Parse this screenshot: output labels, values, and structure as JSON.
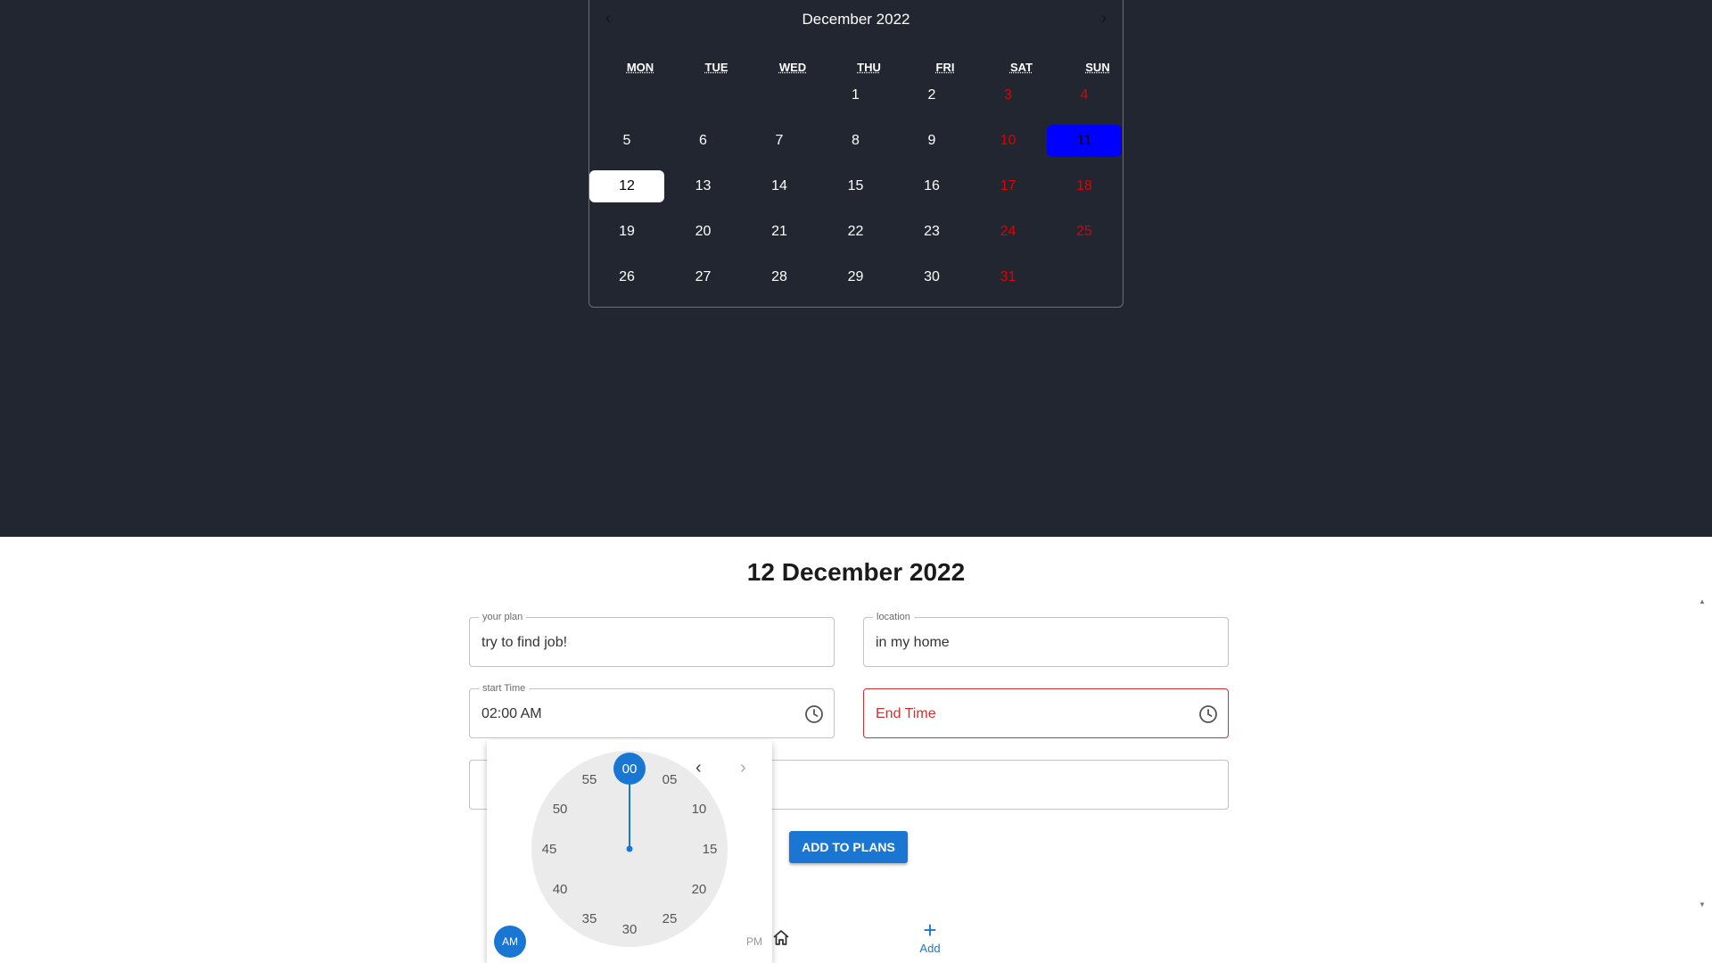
{
  "colors": {
    "accent": "#1976d2",
    "weekend": "#e00000",
    "today_bg": "#0000ff",
    "dark_bg": "#222630",
    "error": "#d32f2f"
  },
  "calendar": {
    "title": "December 2022",
    "prev_label": "‹",
    "next_label": "›",
    "weekdays": [
      "MON",
      "TUE",
      "WED",
      "THU",
      "FRI",
      "SAT",
      "SUN"
    ],
    "weeks": [
      [
        "",
        "",
        "",
        "1",
        "2",
        "3",
        "4"
      ],
      [
        "5",
        "6",
        "7",
        "8",
        "9",
        "10",
        "11"
      ],
      [
        "12",
        "13",
        "14",
        "15",
        "16",
        "17",
        "18"
      ],
      [
        "19",
        "20",
        "21",
        "22",
        "23",
        "24",
        "25"
      ],
      [
        "26",
        "27",
        "28",
        "29",
        "30",
        "31",
        ""
      ]
    ],
    "today": "11",
    "selected": "12"
  },
  "form": {
    "heading": "12 December 2022",
    "plan": {
      "label": "your plan",
      "value": "try to find job!"
    },
    "location": {
      "label": "location",
      "value": "in my home"
    },
    "start_time": {
      "label": "start Time",
      "value": "02:00 AM",
      "icon": "clock-icon"
    },
    "end_time": {
      "placeholder": "End Time",
      "icon": "clock-icon"
    },
    "extra_field": {
      "value": ""
    },
    "add_button": "ADD TO PLANS"
  },
  "bottom_nav": {
    "home_icon": "home-icon",
    "add_icon": "plus-icon",
    "add_label": "Add"
  },
  "time_picker": {
    "selected_minute": "00",
    "minutes": [
      "00",
      "05",
      "10",
      "15",
      "20",
      "25",
      "30",
      "35",
      "40",
      "45",
      "50",
      "55"
    ],
    "am_label": "AM",
    "pm_label": "PM",
    "prev_icon": "chevron-left-icon",
    "next_icon": "chevron-right-icon"
  }
}
